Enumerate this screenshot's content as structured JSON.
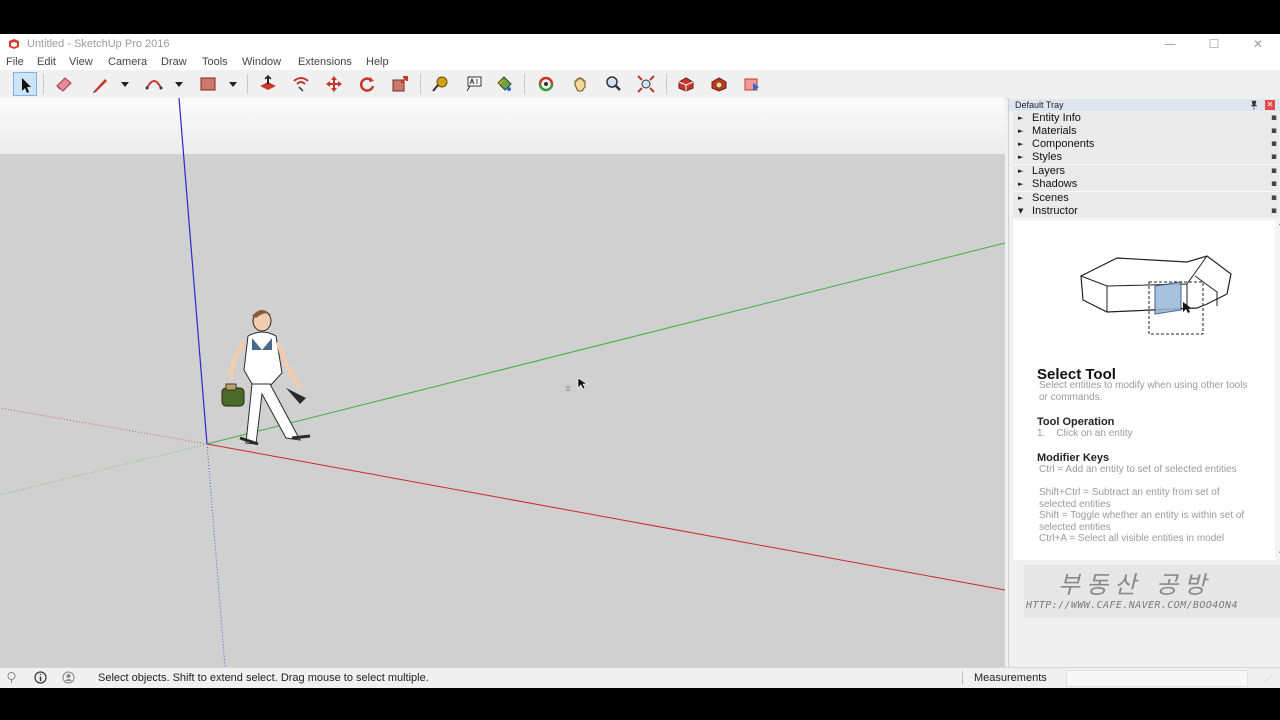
{
  "window": {
    "title": "Untitled - SketchUp Pro 2016",
    "controls": {
      "minimize": "—",
      "maximize": "☐",
      "close": "✕"
    }
  },
  "menu": [
    "File",
    "Edit",
    "View",
    "Camera",
    "Draw",
    "Tools",
    "Window",
    "Extensions",
    "Help"
  ],
  "toolbar": {
    "tools": [
      {
        "icon": "select-arrow-icon",
        "active": true
      },
      {
        "icon": "eraser-icon"
      },
      {
        "icon": "pencil-line-icon",
        "dropdown": true
      },
      {
        "icon": "arc-icon",
        "dropdown": true
      },
      {
        "icon": "rectangle-icon",
        "dropdown": true
      },
      {
        "icon": "push-pull-icon"
      },
      {
        "icon": "offset-icon"
      },
      {
        "icon": "move-icon"
      },
      {
        "icon": "rotate-icon"
      },
      {
        "icon": "scale-icon"
      },
      {
        "icon": "tape-measure-icon"
      },
      {
        "icon": "text-icon"
      },
      {
        "icon": "paint-bucket-icon"
      },
      {
        "icon": "orbit-icon"
      },
      {
        "icon": "pan-icon"
      },
      {
        "icon": "zoom-icon"
      },
      {
        "icon": "zoom-extents-icon"
      },
      {
        "icon": "3d-warehouse-icon"
      },
      {
        "icon": "extension-warehouse-icon"
      },
      {
        "icon": "layout-icon"
      }
    ]
  },
  "colors": {
    "x_axis": "#cc2a2a",
    "y_axis": "#3fb03f",
    "z_axis": "#2a2acc",
    "ground": "#d0d0d0",
    "sky": "#f4f4f4",
    "tray_header": "#dde6f0"
  },
  "tray": {
    "title": "Default Tray",
    "panels": [
      {
        "label": "Entity Info",
        "expanded": false
      },
      {
        "label": "Materials",
        "expanded": false
      },
      {
        "label": "Components",
        "expanded": false
      },
      {
        "label": "Styles",
        "expanded": false
      },
      {
        "label": "Layers",
        "expanded": false
      },
      {
        "label": "Shadows",
        "expanded": false
      },
      {
        "label": "Scenes",
        "expanded": false
      },
      {
        "label": "Instructor",
        "expanded": true
      }
    ],
    "instructor": {
      "title": "Select Tool",
      "description": "Select entities to modify when using other tools or commands.",
      "operation_heading": "Tool Operation",
      "operation_step": "1.    Click on an entity",
      "modifier_heading": "Modifier Keys",
      "modifiers": [
        "Ctrl = Add an entity to set of selected entities",
        "Shift+Ctrl = Subtract an entity from set of selected entities",
        "Shift = Toggle whether an entity is within set of selected entities",
        "Ctrl+A = Select all visible entities in model"
      ]
    }
  },
  "watermark": {
    "text": "부동산 공방",
    "url": "HTTP://WWW.CAFE.NAVER.COM/BOO4ON4"
  },
  "status": {
    "hint": "Select objects. Shift to extend select. Drag mouse to select multiple.",
    "measurements_label": "Measurements",
    "measurements_value": ""
  }
}
